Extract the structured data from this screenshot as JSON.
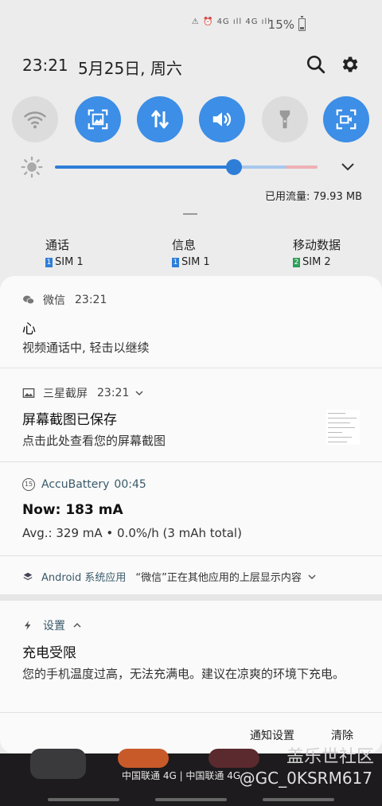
{
  "status_bar": {
    "icons": "⚠ ⏰ 4G ıll 4G ıll",
    "battery": "15%"
  },
  "header": {
    "time": "23:21",
    "date": "5月25日, 周六"
  },
  "colors": {
    "accent": "#3c8ee6",
    "toggle_off": "#dcdcdc"
  },
  "quick_toggles": [
    {
      "name": "wifi-icon",
      "state": "off"
    },
    {
      "name": "screenshot-icon",
      "state": "on"
    },
    {
      "name": "mobile-data-icon",
      "state": "on"
    },
    {
      "name": "sound-icon",
      "state": "on"
    },
    {
      "name": "flashlight-icon",
      "state": "off"
    },
    {
      "name": "screen-record-icon",
      "state": "on"
    }
  ],
  "brightness": {
    "level": 0.68
  },
  "data_usage": "已用流量: 79.93 MB",
  "sim_defaults": [
    {
      "title": "通话",
      "sim": "SIM 1",
      "badge": "1",
      "badge_color": "#2e7ed8"
    },
    {
      "title": "信息",
      "sim": "SIM 1",
      "badge": "1",
      "badge_color": "#2e7ed8"
    },
    {
      "title": "移动数据",
      "sim": "SIM 2",
      "badge": "2",
      "badge_color": "#2e9e58"
    }
  ],
  "notifications": {
    "wechat": {
      "app": "微信",
      "time": "23:21",
      "title": "心",
      "body": "视频通话中, 轻击以继续"
    },
    "screenshot": {
      "app": "三星截屏",
      "time": "23:21",
      "title": "屏幕截图已保存",
      "body": "点击此处查看您的屏幕截图"
    },
    "accubattery": {
      "app": "AccuBattery",
      "time": "00:45",
      "badge": "15",
      "title": "Now: 183 mA",
      "body": "Avg.: 329 mA • 0.0%/h (3 mAh total)"
    },
    "android": {
      "app": "Android 系统应用",
      "body": "“微信”正在其他应用的上层显示内容"
    },
    "settings": {
      "app": "设置",
      "title": "充电受限",
      "body": "您的手机温度过高，无法充满电。建议在凉爽的环境下充电。"
    }
  },
  "actions": {
    "settings": "通知设置",
    "clear": "清除"
  },
  "bottom": {
    "carrier": "中国联通 4G | 中国联通 4G",
    "watermark_logo": "盖乐世社区",
    "watermark_user": "@GC_0KSRM617"
  }
}
